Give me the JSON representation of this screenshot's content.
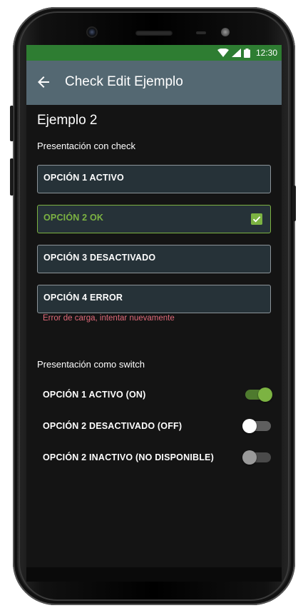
{
  "status_bar": {
    "time": "12:30",
    "color": "#2e7d32"
  },
  "app_bar": {
    "title": "Check Edit Ejemplo",
    "back_icon": "arrow-left-icon",
    "color": "#546872"
  },
  "content": {
    "heading": "Ejemplo 2",
    "check_section": {
      "title": "Presentación con check",
      "options": [
        {
          "label": "OPCIÓN 1 ACTIVO",
          "state": "active"
        },
        {
          "label": "OPCIÓN 2 OK",
          "state": "ok",
          "checked": true
        },
        {
          "label": "OPCIÓN 3 DESACTIVADO",
          "state": "disabled"
        },
        {
          "label": "OPCIÓN 4 ERROR",
          "state": "error"
        }
      ],
      "error_message": "Error de carga, intentar nuevamente"
    },
    "switch_section": {
      "title": "Presentación como switch",
      "switches": [
        {
          "label": "OPCIÓN 1 ACTIVO (ON)",
          "state": "on"
        },
        {
          "label": "OPCIÓN 2 DESACTIVADO (OFF)",
          "state": "off"
        },
        {
          "label": "OPCIÓN 2 INACTIVO (NO DISPONIBLE)",
          "state": "disabled"
        }
      ]
    }
  },
  "colors": {
    "accent": "#7cb342",
    "error": "#e06a7a",
    "background": "#141414",
    "field": "#263238"
  }
}
